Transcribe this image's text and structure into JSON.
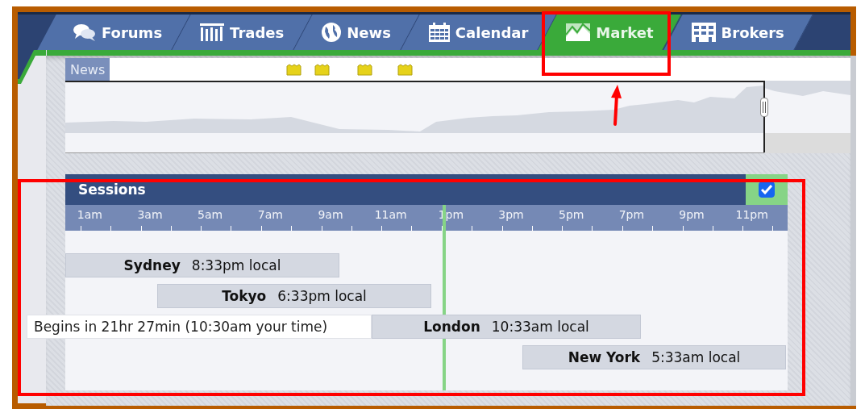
{
  "nav_tabs": [
    {
      "label": "Forums",
      "selected": false
    },
    {
      "label": "Trades",
      "selected": false
    },
    {
      "label": "News",
      "selected": false
    },
    {
      "label": "Calendar",
      "selected": false
    },
    {
      "label": "Market",
      "selected": true
    },
    {
      "label": "Brokers",
      "selected": false
    }
  ],
  "news_strip": {
    "label": "News"
  },
  "sessions": {
    "title": "Sessions",
    "checked": true,
    "hours": [
      "1am",
      "3am",
      "5am",
      "7am",
      "9am",
      "11am",
      "1pm",
      "3pm",
      "5pm",
      "7pm",
      "9pm",
      "11pm"
    ],
    "current_time": {
      "level": 0.525
    },
    "rows": [
      {
        "city": "Sydney",
        "local_time": "8:33pm local"
      },
      {
        "city": "Tokyo",
        "local_time": "6:33pm local"
      },
      {
        "city": "London",
        "local_time": "10:33am local",
        "note": "Begins in 21hr 27min (10:30am your time)"
      },
      {
        "city": "New York",
        "local_time": "5:33am local"
      }
    ]
  }
}
